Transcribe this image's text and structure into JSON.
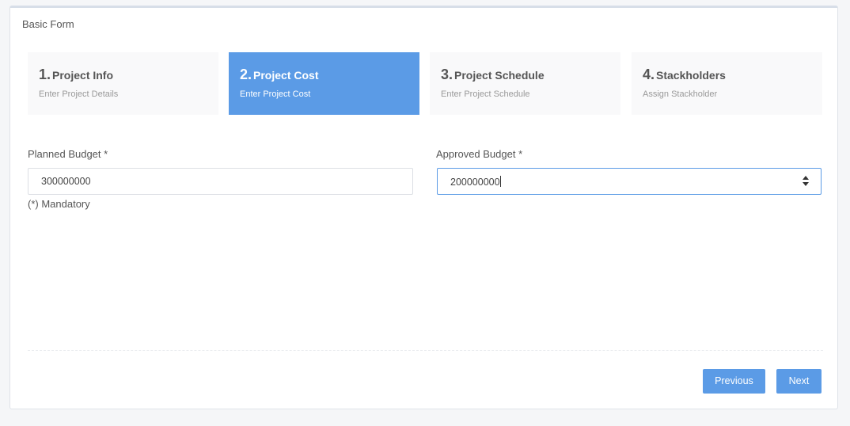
{
  "card": {
    "title": "Basic Form"
  },
  "steps": [
    {
      "num": "1.",
      "title": "Project Info",
      "sub": "Enter Project Details",
      "active": false
    },
    {
      "num": "2.",
      "title": "Project Cost",
      "sub": "Enter Project Cost",
      "active": true
    },
    {
      "num": "3.",
      "title": "Project Schedule",
      "sub": "Enter Project Schedule",
      "active": false
    },
    {
      "num": "4.",
      "title": "Stackholders",
      "sub": "Assign Stackholder",
      "active": false
    }
  ],
  "form": {
    "planned_label": "Planned Budget *",
    "planned_value": "300000000",
    "approved_label": "Approved Budget *",
    "approved_value": "200000000",
    "mandatory_note": "(*) Mandatory"
  },
  "buttons": {
    "previous": "Previous",
    "next": "Next"
  },
  "colors": {
    "accent": "#5b9be6",
    "step_bg": "#f9f9fa"
  }
}
